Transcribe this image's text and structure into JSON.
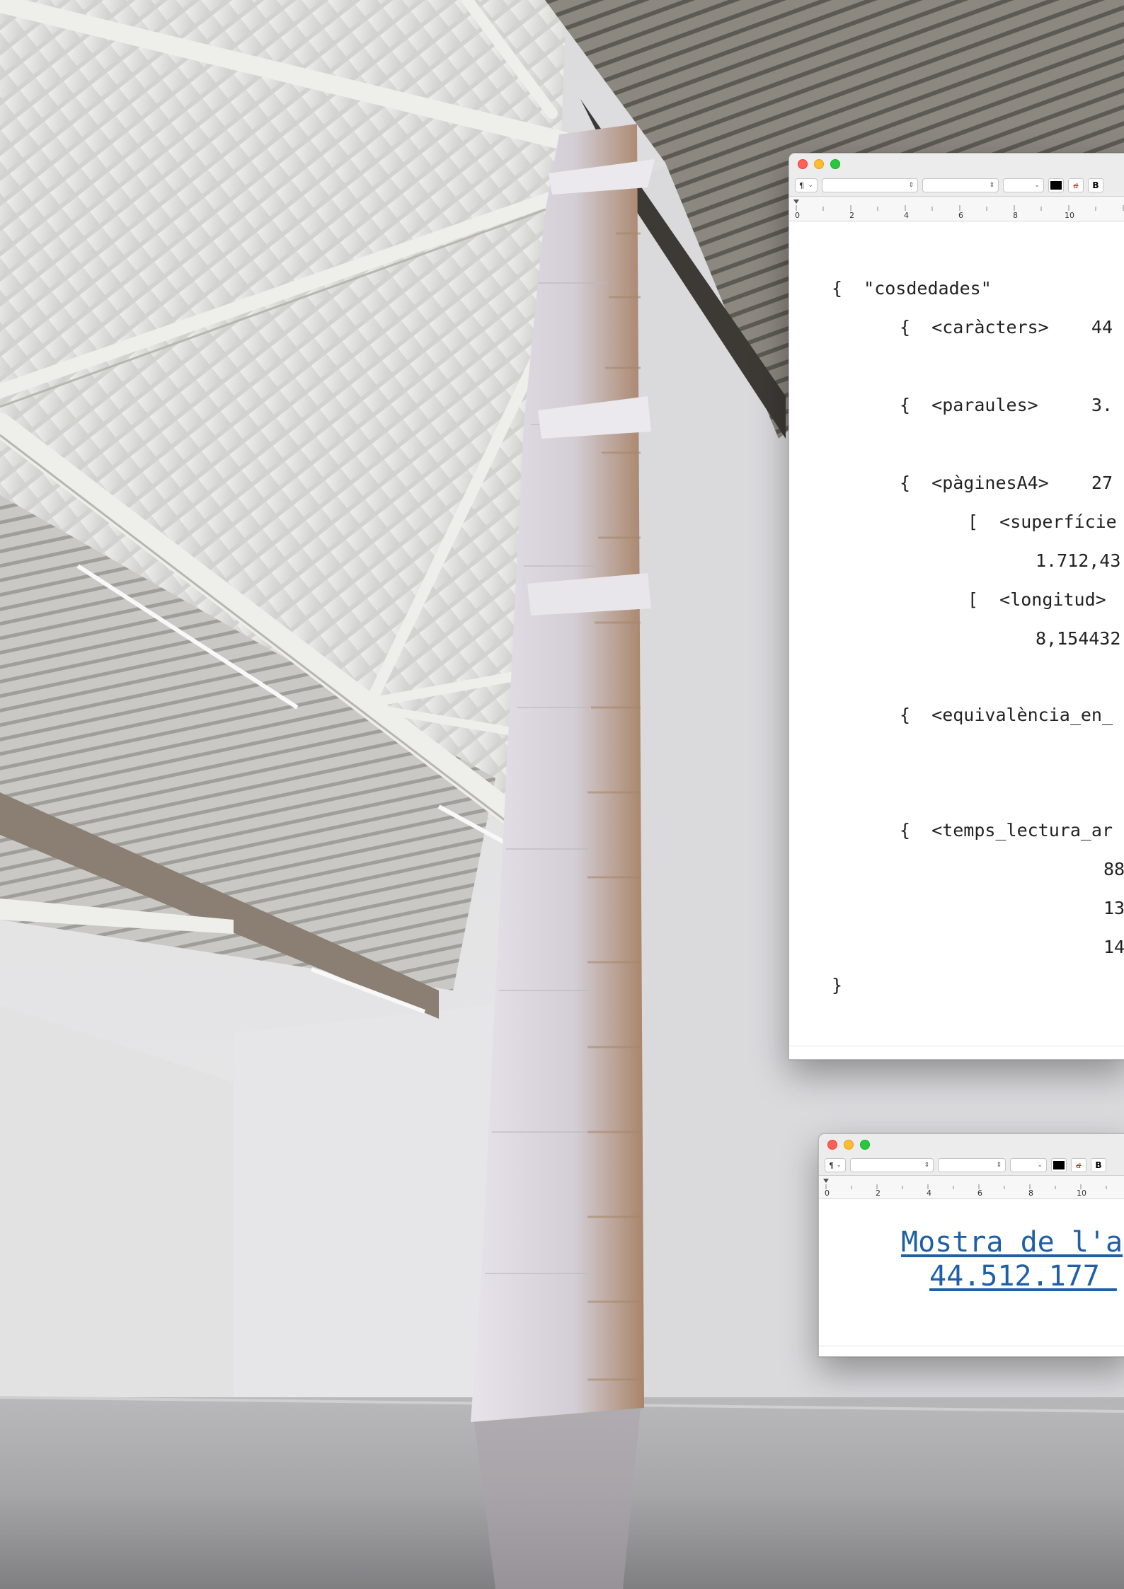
{
  "main_window": {
    "toolbar": {
      "paragraph_style": "¶"
    },
    "ruler_marks": [
      "0",
      "2",
      "4",
      "6",
      "8",
      "10"
    ],
    "lines": [
      "{  \"cosdedades\"",
      "{  <caràcters>    44",
      "{  <paraules>     3.",
      "{  <pàginesA4>    27",
      "[  <superfície",
      "1.712,43",
      "[  <longitud>",
      "8,154432",
      "{  <equivalència_en_",
      "{  <temps_lectura_ar",
      "88",
      "13",
      "14",
      "}"
    ]
  },
  "small_window": {
    "toolbar": {
      "paragraph_style": "¶"
    },
    "ruler_marks": [
      "0",
      "2",
      "4",
      "6",
      "8",
      "10"
    ],
    "link_line_1": "Mostra de l'a",
    "link_line_2": "44.512.177 "
  },
  "colors": {
    "link": "#1f5fa8",
    "close": "#fe5f57",
    "minimize": "#febc2e",
    "zoom": "#28c840"
  }
}
